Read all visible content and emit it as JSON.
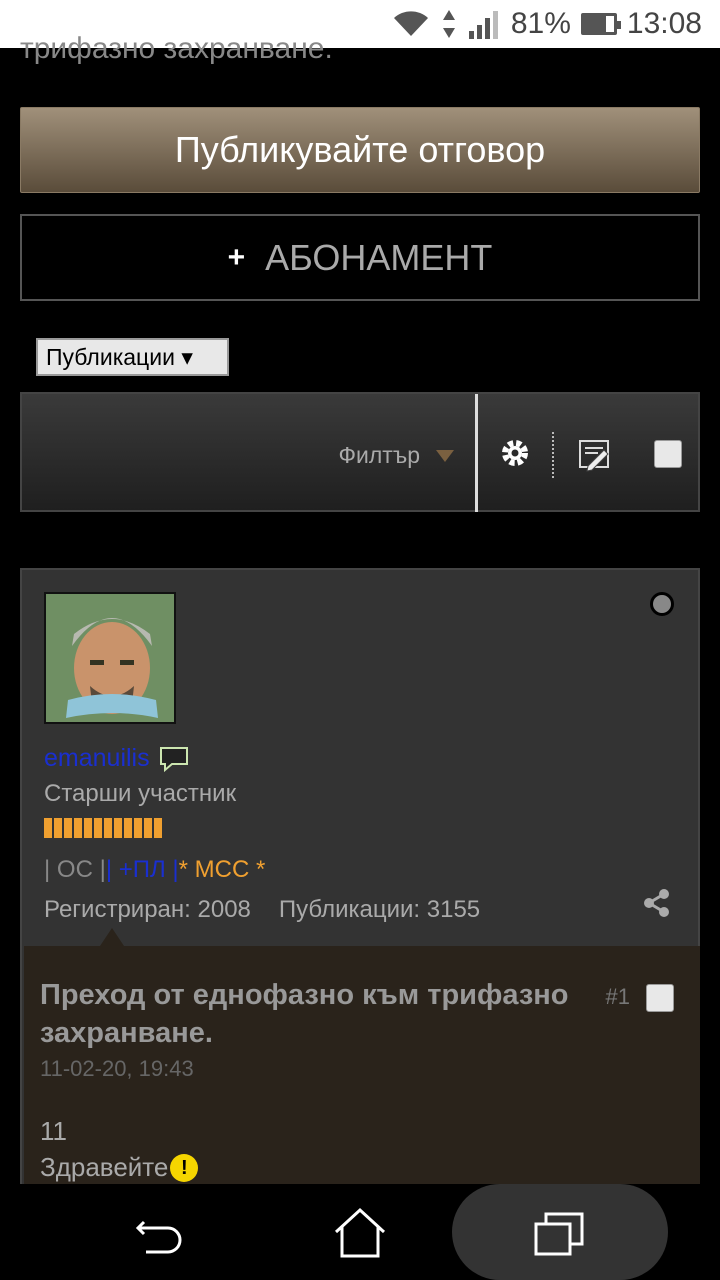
{
  "status_bar": {
    "battery": "81%",
    "time": "13:08"
  },
  "previous_text": "трифазно захранване.",
  "actions": {
    "reply_label": "Публикувайте отговор",
    "subscribe_label": "АБОНАМЕНТ",
    "subscribe_icon": "+"
  },
  "view_select": {
    "value": "Публикации ▾"
  },
  "toolbar": {
    "filter_label": "Филтър"
  },
  "post": {
    "username": "emanuilis",
    "user_title": "Старши участник",
    "signature": {
      "part1": "| ОС |",
      "part2": "| +ПЛ |",
      "part3": "* МСС *"
    },
    "registered": "Регистриран: 2008",
    "posts": "Публикации: 3155",
    "title": "Преход от еднофазно към трифазно захранване.",
    "number": "#1",
    "date": "11-02-20, 19:43",
    "body_line1": "11",
    "body_line2": "Здравейте"
  },
  "colors": {
    "accent": "#a0907a",
    "username": "#1a2fd0",
    "signature_orange": "#f0a030"
  }
}
